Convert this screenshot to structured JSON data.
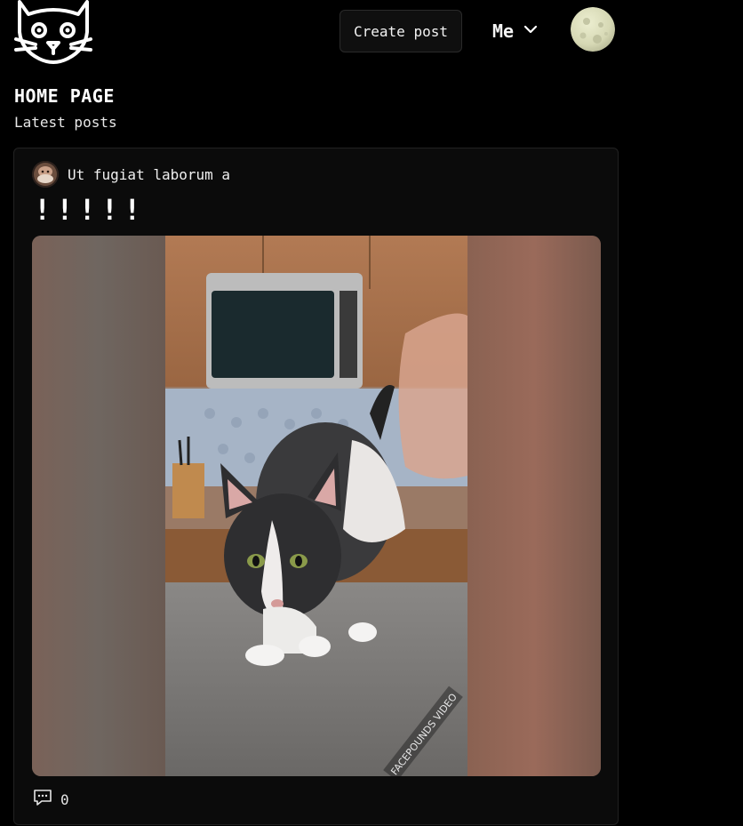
{
  "header": {
    "logo_icon": "cat-logo-icon",
    "create_post_label": "Create post",
    "user_menu_label": "Me",
    "user_menu_icon": "chevron-down-icon",
    "avatar_icon": "moon-avatar-icon"
  },
  "page": {
    "title": "HOME PAGE",
    "subtitle": "Latest posts"
  },
  "posts": [
    {
      "author": "Ut fugiat laborum a",
      "title": "!!!!!",
      "media_description_icon": "cat-video-thumbnail",
      "comments_icon": "comment-bubble-icon",
      "comments_count": "0"
    }
  ],
  "colors": {
    "background": "#000000",
    "card_background": "#0b0b0b",
    "card_border": "#222222",
    "button_background": "#0f0f0f",
    "text_primary": "#ffffff"
  }
}
